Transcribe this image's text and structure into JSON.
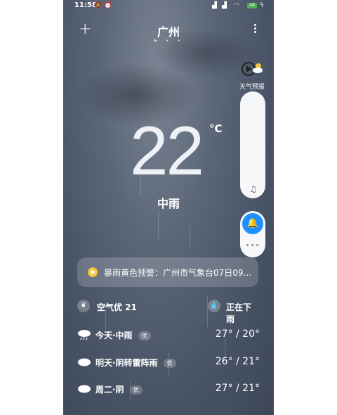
{
  "status_bar": {
    "time": "11:58",
    "battery": "48"
  },
  "header": {
    "city": "广州",
    "add_icon": "plus-icon",
    "more_icon": "more-vertical-icon",
    "page_dots": "➤ • •"
  },
  "current": {
    "temperature": "22",
    "unit": "°C",
    "condition": "中雨"
  },
  "side_panel": {
    "forecast_video_label": "天气预报",
    "forecast_video_icon": "play-weather-icon",
    "music_icon": "music-note-icon",
    "bell_icon": "bell-icon",
    "more_dots": "•••",
    "bell_color": "#1e90ff"
  },
  "alert": {
    "icon": "warning-sun-icon",
    "text": "暴雨黄色预警：广州市气象台07日09..."
  },
  "air": {
    "aqi_text": "空气优 21",
    "aqi_icon": "leaf-icon",
    "rain_icon": "drop-icon",
    "rain_status": "正在下雨"
  },
  "forecast": [
    {
      "label": "今天·中雨",
      "badge": "优",
      "temp": "27° / 20°",
      "icon": "rain-cloud-icon"
    },
    {
      "label": "明天·阴转雷阵雨",
      "badge": "优",
      "temp": "26° / 21°",
      "icon": "cloud-icon"
    },
    {
      "label": "周二·阴",
      "badge": "优",
      "temp": "27° / 21°",
      "icon": "cloud-icon"
    }
  ]
}
